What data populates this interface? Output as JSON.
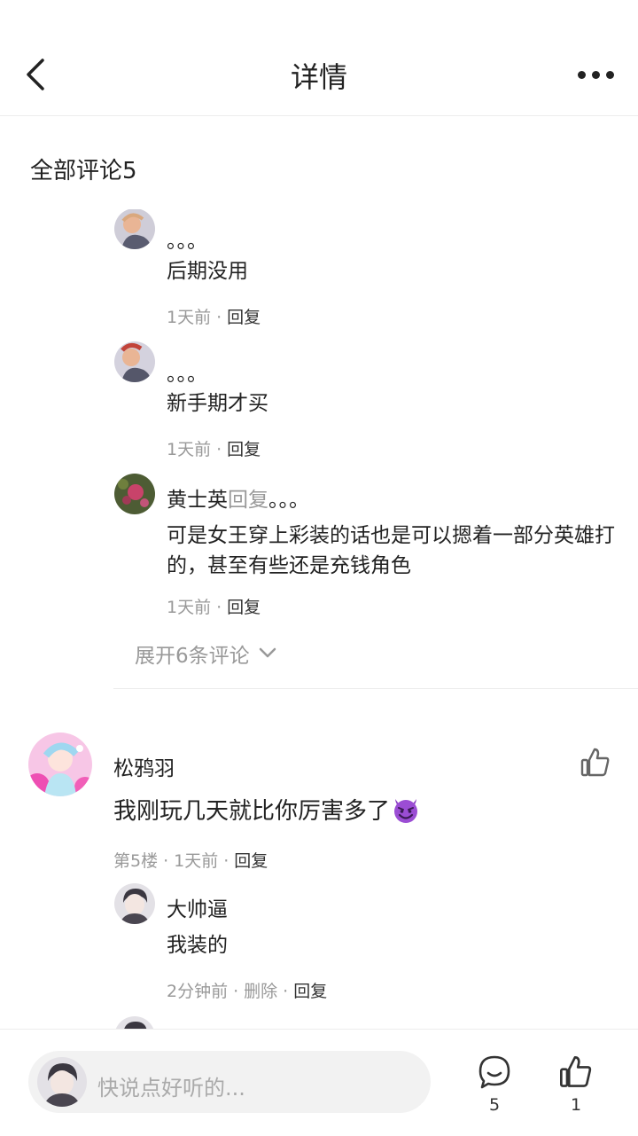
{
  "header": {
    "title": "详情",
    "back_icon": "chevron-left-icon",
    "more_icon": "more-dots-icon"
  },
  "section_title": "全部评论5",
  "replies": [
    {
      "user": "。。。",
      "text": "后期没用",
      "time": "1天前",
      "sep": "·",
      "reply_label": "回复"
    },
    {
      "user": "。。。",
      "text": "新手期才买",
      "time": "1天前",
      "sep": "·",
      "reply_label": "回复"
    },
    {
      "user": "黄士英",
      "reply_word": "回复",
      "reply_target": "。。。",
      "text": "可是女王穿上彩装的话也是可以摁着一部分英雄打的，甚至有些还是充钱角色",
      "time": "1天前",
      "sep": "·",
      "reply_label": "回复"
    }
  ],
  "expand_label": "展开6条评论",
  "comment": {
    "user": "松鸦羽",
    "text": "我刚玩几天就比你厉害多了",
    "floor": "第5楼",
    "time": "1天前",
    "sep": "·",
    "reply_label": "回复",
    "sub_reply": {
      "user": "大帅逼",
      "text": "我装的",
      "time": "2分钟前",
      "sep": "·",
      "delete_label": "删除",
      "reply_label": "回复"
    }
  },
  "bottom": {
    "placeholder": "快说点好听的...",
    "comment_count": "5",
    "like_count": "1"
  },
  "colors": {
    "muted": "#999999",
    "text": "#222222",
    "divider": "#ececec",
    "input_bg": "#f2f2f2"
  }
}
